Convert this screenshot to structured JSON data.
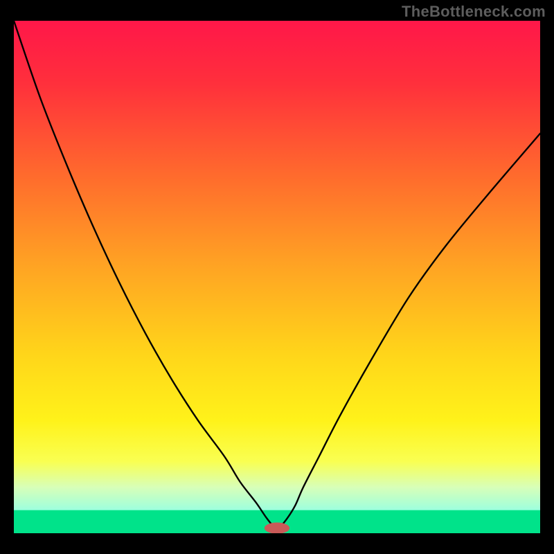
{
  "watermark": "TheBottleneck.com",
  "chart_data": {
    "type": "line",
    "title": "",
    "xlabel": "",
    "ylabel": "",
    "xlim": [
      0,
      100
    ],
    "ylim": [
      0,
      100
    ],
    "background_gradient_stops": [
      {
        "offset": 0,
        "color": "#ff1749"
      },
      {
        "offset": 12,
        "color": "#ff2f3c"
      },
      {
        "offset": 30,
        "color": "#ff6a2d"
      },
      {
        "offset": 48,
        "color": "#ffa423"
      },
      {
        "offset": 65,
        "color": "#ffd51a"
      },
      {
        "offset": 78,
        "color": "#fff21a"
      },
      {
        "offset": 86,
        "color": "#f9ff52"
      },
      {
        "offset": 91,
        "color": "#d8ffb8"
      },
      {
        "offset": 95.5,
        "color": "#9dffde"
      },
      {
        "offset": 100,
        "color": "#00e38a"
      }
    ],
    "green_band": {
      "y_from": 95.5,
      "y_to": 100
    },
    "x": [
      0,
      5,
      10,
      15,
      20,
      25,
      30,
      35,
      40,
      43,
      46,
      48,
      49.5,
      50.5,
      52,
      53.5,
      55,
      58,
      62,
      68,
      75,
      82,
      90,
      100
    ],
    "series": [
      {
        "name": "bottleneck-curve",
        "values": [
          0,
          15,
          28,
          40,
          51,
          61,
          70,
          78,
          85,
          90,
          94,
          97,
          98.8,
          98.8,
          97,
          94.5,
          91,
          85,
          77,
          66,
          54,
          44,
          34,
          22
        ]
      }
    ],
    "marker": {
      "x": 50,
      "y": 99,
      "rx": 2.4,
      "ry": 1.1,
      "color": "#c95a58"
    }
  }
}
